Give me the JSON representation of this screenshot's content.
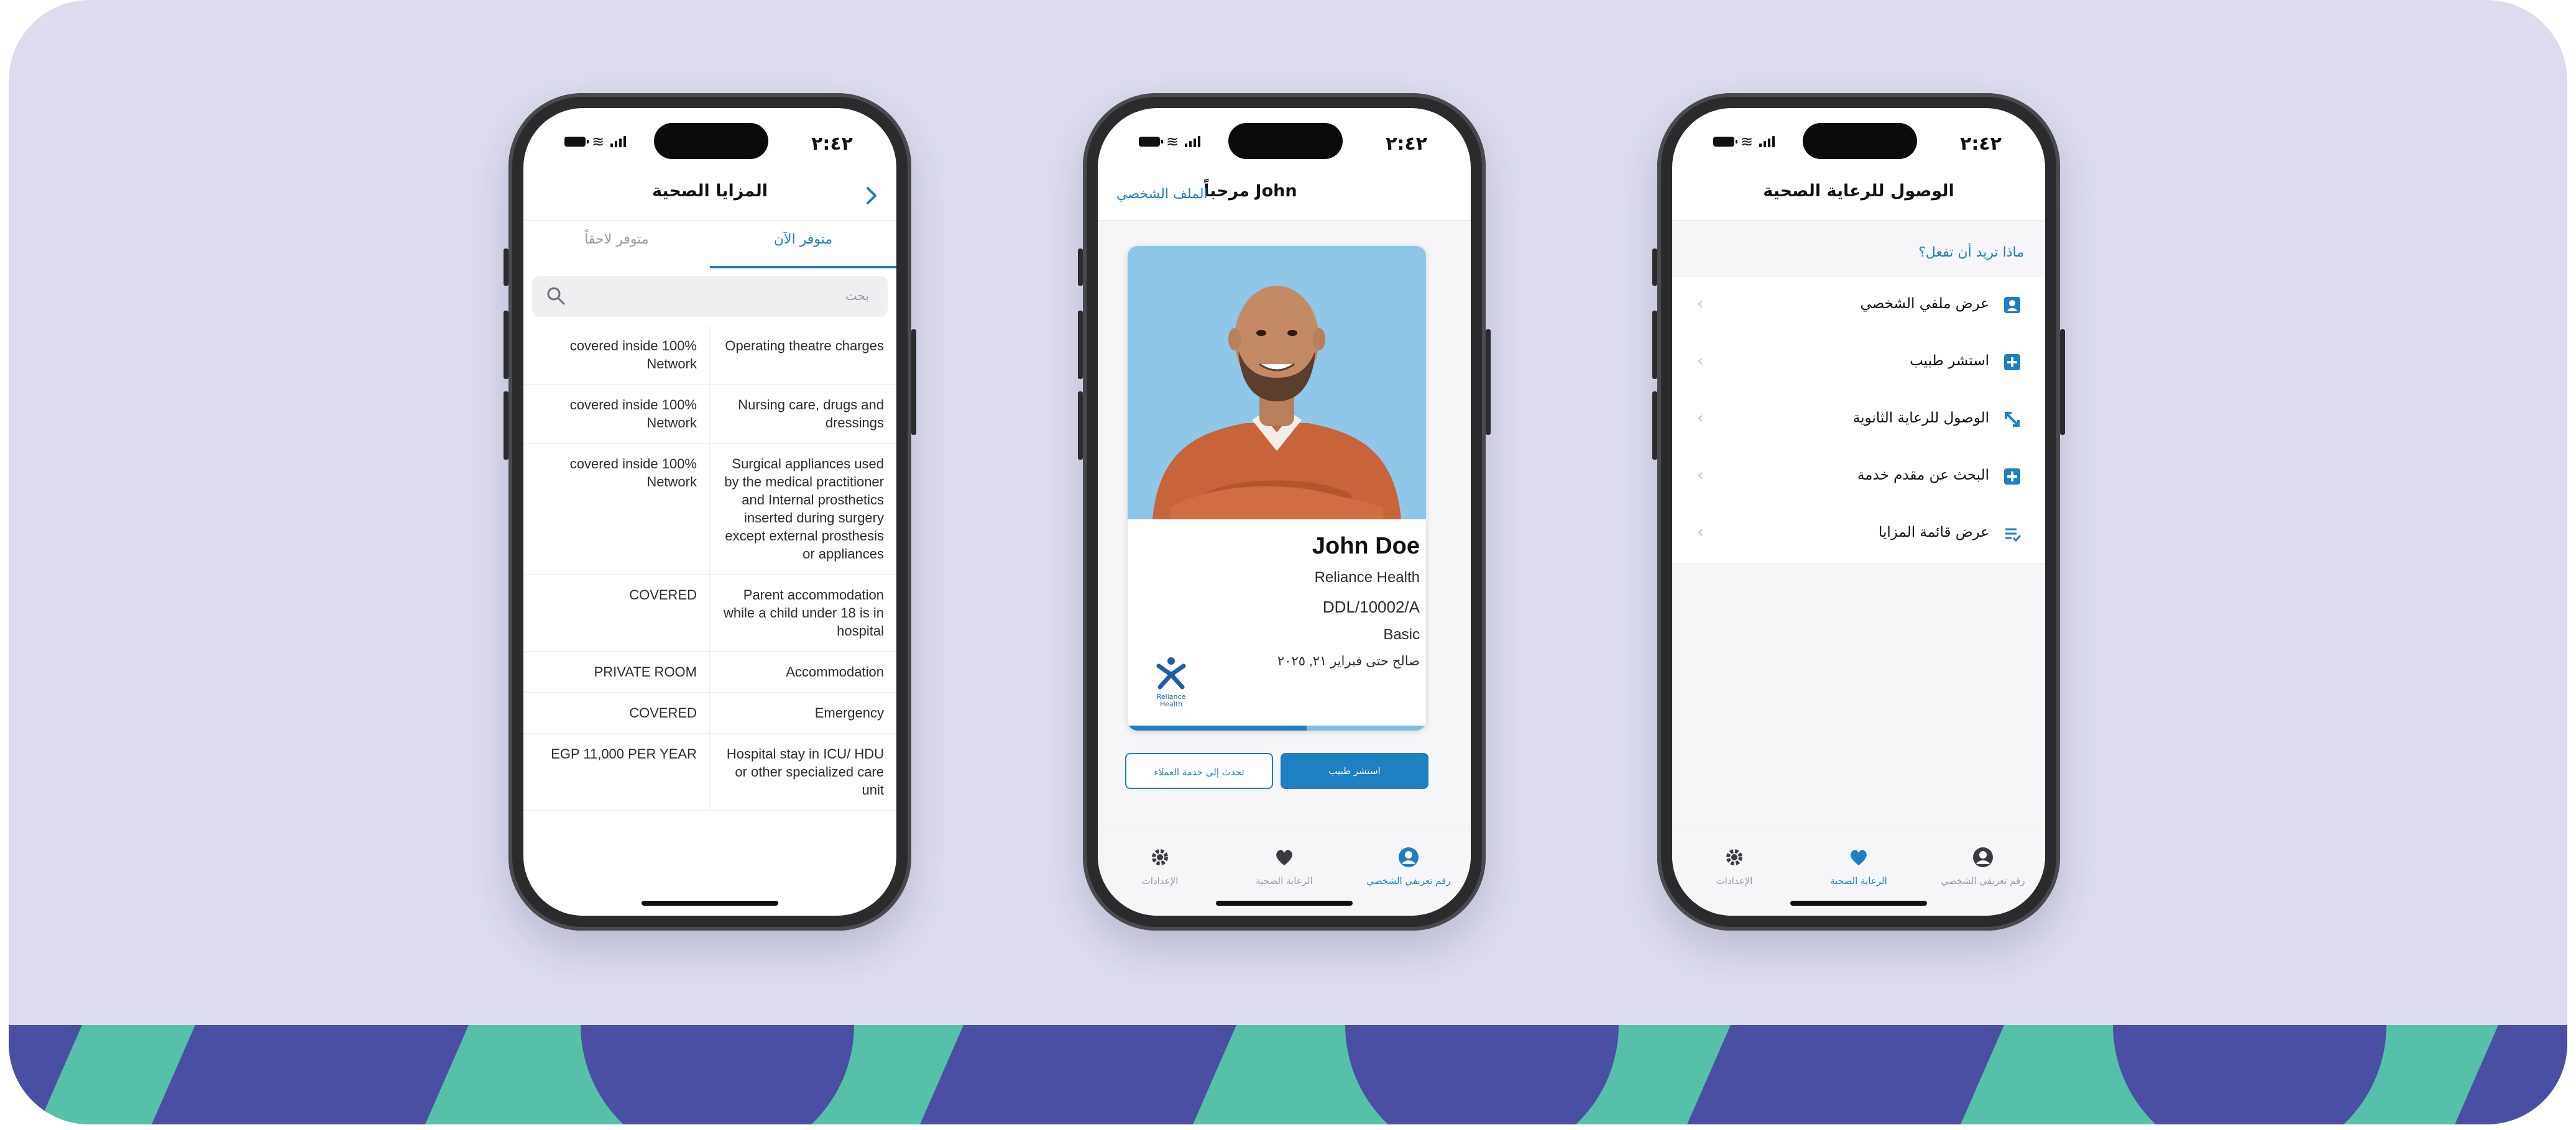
{
  "phone1": {
    "status_time": "٢:٤٢",
    "title": "المزايا الصحية",
    "back_icon": "chevron-icon",
    "tabs": [
      {
        "label": "متوفر الآن",
        "active": true
      },
      {
        "label": "متوفر لاحقاً",
        "active": false
      }
    ],
    "search_placeholder": "بحث",
    "benefits": [
      {
        "coverage": "covered inside 100% Network",
        "name": "Operating theatre charges"
      },
      {
        "coverage": "covered inside 100% Network",
        "name": "Nursing care, drugs and dressings"
      },
      {
        "coverage": "covered inside 100% Network",
        "name": "Surgical appliances used by the medical practitioner and Internal prosthetics inserted during surgery except external prosthesis or appliances"
      },
      {
        "coverage": "COVERED",
        "name": "Parent accommodation while a child under 18 is in hospital"
      },
      {
        "coverage": "PRIVATE ROOM",
        "name": "Accommodation"
      },
      {
        "coverage": "COVERED",
        "name": "Emergency"
      },
      {
        "coverage": "EGP 11,000 PER YEAR",
        "name": "Hospital stay in ICU/ HDU or other specialized care unit"
      }
    ]
  },
  "phone2": {
    "status_time": "٢:٤٢",
    "title": "مرحباً John",
    "profile_link": "الملف الشخصي",
    "card": {
      "name": "John Doe",
      "insurer": "Reliance Health",
      "member_id": "DDL/10002/A",
      "plan": "Basic",
      "validity": "صالح حتى فبراير ٢١, ٢٠٢٥",
      "logo_text": "Reliance Health"
    },
    "primary_button": "استشر طبيب",
    "secondary_button": "تحدث إلى خدمة العملاء",
    "nav": [
      {
        "label": "رقم تعريفي الشخصي",
        "icon": "user-circle-icon",
        "active": true
      },
      {
        "label": "الرعاية الصحية",
        "icon": "heart-icon",
        "active": false
      },
      {
        "label": "الإعدادات",
        "icon": "gear-icon",
        "active": false
      }
    ]
  },
  "phone3": {
    "status_time": "٢:٤٢",
    "title": "الوصول للرعاية الصحية",
    "question": "ماذا تريد أن تفعل؟",
    "menu": [
      {
        "label": "عرض ملفي الشخصي",
        "icon": "profile-card-icon"
      },
      {
        "label": "استشر طبيب",
        "icon": "medical-plus-icon"
      },
      {
        "label": "الوصول للرعاية الثانوية",
        "icon": "expand-arrows-icon"
      },
      {
        "label": "البحث عن مقدم خدمة",
        "icon": "provider-plus-icon"
      },
      {
        "label": "عرض قائمة المزايا",
        "icon": "list-check-icon"
      }
    ],
    "nav": [
      {
        "label": "رقم تعريفي الشخصي",
        "icon": "user-circle-icon",
        "active": false
      },
      {
        "label": "الرعاية الصحية",
        "icon": "heart-icon",
        "active": true
      },
      {
        "label": "الإعدادات",
        "icon": "gear-icon",
        "active": false
      }
    ]
  },
  "colors": {
    "background": "#dcdcee",
    "accent": "#1e7fc1",
    "band_green": "#56c1a8",
    "band_purple": "#4b4fa3"
  }
}
